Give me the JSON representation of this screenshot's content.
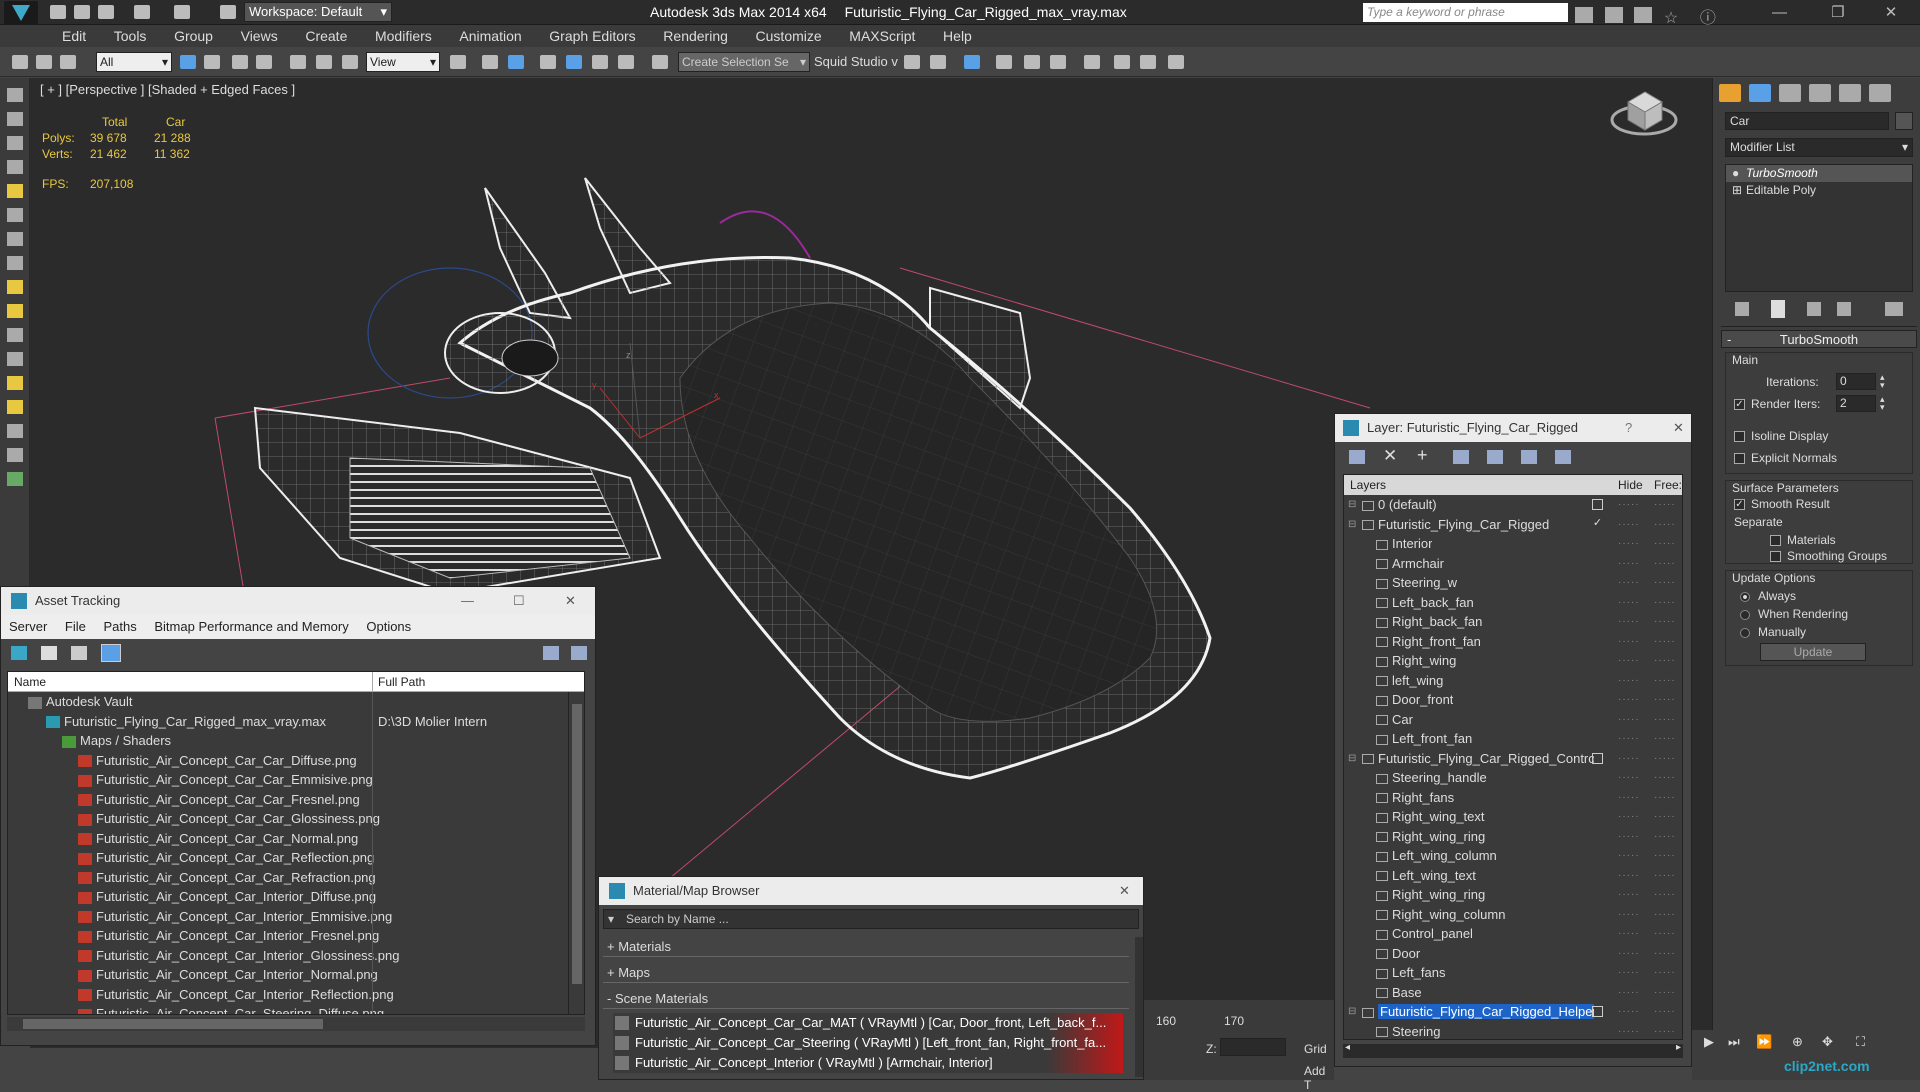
{
  "app": {
    "title": "Autodesk 3ds Max  2014 x64",
    "file": "Futuristic_Flying_Car_Rigged_max_vray.max",
    "workspace": "Workspace: Default",
    "search_placeholder": "Type a keyword or phrase"
  },
  "menu": [
    "Edit",
    "Tools",
    "Group",
    "Views",
    "Create",
    "Modifiers",
    "Animation",
    "Graph Editors",
    "Rendering",
    "Customize",
    "MAXScript",
    "Help"
  ],
  "toolbar": {
    "filter": "All",
    "view": "View",
    "selection_set": "Create Selection Se",
    "squid": "Squid Studio v"
  },
  "viewport": {
    "label": "[ + ] [Perspective ] [Shaded + Edged Faces ]",
    "stats": {
      "total_header": "Total",
      "car_header": "Car",
      "polys_label": "Polys:",
      "polys_total": "39 678",
      "polys_car": "21 288",
      "verts_label": "Verts:",
      "verts_total": "21 462",
      "verts_car": "11 362",
      "fps_label": "FPS:",
      "fps_value": "207,108"
    },
    "axis_x": "x",
    "axis_y": "y",
    "axis_z": "z"
  },
  "asset_tracking": {
    "title": "Asset Tracking",
    "menu": [
      "Server",
      "File",
      "Paths",
      "Bitmap Performance and Memory",
      "Options"
    ],
    "col_name": "Name",
    "col_path": "Full Path",
    "vault": "Autodesk Vault",
    "max_file": "Futuristic_Flying_Car_Rigged_max_vray.max",
    "max_path": "D:\\3D Molier Intern",
    "maps_folder": "Maps / Shaders",
    "files": [
      "Futuristic_Air_Concept_Car_Car_Diffuse.png",
      "Futuristic_Air_Concept_Car_Car_Emmisive.png",
      "Futuristic_Air_Concept_Car_Car_Fresnel.png",
      "Futuristic_Air_Concept_Car_Car_Glossiness.png",
      "Futuristic_Air_Concept_Car_Car_Normal.png",
      "Futuristic_Air_Concept_Car_Car_Reflection.png",
      "Futuristic_Air_Concept_Car_Car_Refraction.png",
      "Futuristic_Air_Concept_Car_Interior_Diffuse.png",
      "Futuristic_Air_Concept_Car_Interior_Emmisive.png",
      "Futuristic_Air_Concept_Car_Interior_Fresnel.png",
      "Futuristic_Air_Concept_Car_Interior_Glossiness.png",
      "Futuristic_Air_Concept_Car_Interior_Normal.png",
      "Futuristic_Air_Concept_Car_Interior_Reflection.png",
      "Futuristic_Air_Concept_Car_Steering_Diffuse.png"
    ]
  },
  "material_browser": {
    "title": "Material/Map Browser",
    "search_placeholder": "Search by Name ...",
    "groups": [
      "+ Materials",
      "+ Maps",
      "- Scene Materials"
    ],
    "materials": [
      "Futuristic_Air_Concept_Car_Car_MAT  ( VRayMtl ) [Car, Door_front, Left_back_f...",
      "Futuristic_Air_Concept_Car_Steering  ( VRayMtl ) [Left_front_fan, Right_front_fa...",
      "Futuristic_Air_Concept_Interior  ( VRayMtl ) [Armchair, Interior]"
    ]
  },
  "layer_window": {
    "title": "Layer: Futuristic_Flying_Car_Rigged",
    "help": "?",
    "col_layers": "Layers",
    "col_hide": "Hide",
    "col_freeze": "Free:",
    "rows": [
      {
        "label": "0 (default)",
        "level": 0,
        "group": true
      },
      {
        "label": "Futuristic_Flying_Car_Rigged",
        "level": 0,
        "group": true
      },
      {
        "label": "Interior",
        "level": 1,
        "group": false
      },
      {
        "label": "Armchair",
        "level": 1,
        "group": false
      },
      {
        "label": "Steering_w",
        "level": 1,
        "group": false
      },
      {
        "label": "Left_back_fan",
        "level": 1,
        "group": false
      },
      {
        "label": "Right_back_fan",
        "level": 1,
        "group": false
      },
      {
        "label": "Right_front_fan",
        "level": 1,
        "group": false
      },
      {
        "label": "Right_wing",
        "level": 1,
        "group": false
      },
      {
        "label": "left_wing",
        "level": 1,
        "group": false
      },
      {
        "label": "Door_front",
        "level": 1,
        "group": false
      },
      {
        "label": "Car",
        "level": 1,
        "group": false
      },
      {
        "label": "Left_front_fan",
        "level": 1,
        "group": false
      },
      {
        "label": "Futuristic_Flying_Car_Rigged_Contro",
        "level": 0,
        "group": true
      },
      {
        "label": "Steering_handle",
        "level": 1,
        "group": false
      },
      {
        "label": "Right_fans",
        "level": 1,
        "group": false
      },
      {
        "label": "Right_wing_text",
        "level": 1,
        "group": false
      },
      {
        "label": "Right_wing_ring",
        "level": 1,
        "group": false
      },
      {
        "label": "Left_wing_column",
        "level": 1,
        "group": false
      },
      {
        "label": "Left_wing_text",
        "level": 1,
        "group": false
      },
      {
        "label": "Right_wing_ring",
        "level": 1,
        "group": false
      },
      {
        "label": "Right_wing_column",
        "level": 1,
        "group": false
      },
      {
        "label": "Control_panel",
        "level": 1,
        "group": false
      },
      {
        "label": "Door",
        "level": 1,
        "group": false
      },
      {
        "label": "Left_fans",
        "level": 1,
        "group": false
      },
      {
        "label": "Base",
        "level": 1,
        "group": false
      },
      {
        "label": "Futuristic_Flying_Car_Rigged_Helper",
        "level": 0,
        "group": true,
        "selected": true
      },
      {
        "label": "Steering",
        "level": 1,
        "group": false
      }
    ]
  },
  "command_panel": {
    "object_name": "Car",
    "modifier_list": "Modifier List",
    "stack": [
      "TurboSmooth",
      "Editable Poly"
    ],
    "rollout_title": "TurboSmooth",
    "main_label": "Main",
    "iterations_label": "Iterations:",
    "iterations_value": "0",
    "render_iters_label": "Render Iters:",
    "render_iters_value": "2",
    "isoline": "Isoline Display",
    "explicit_normals": "Explicit Normals",
    "surface_params": "Surface Parameters",
    "smooth_result": "Smooth Result",
    "separate": "Separate",
    "materials": "Materials",
    "smoothing_groups": "Smoothing Groups",
    "update_options": "Update Options",
    "always": "Always",
    "when_rendering": "When Rendering",
    "manually": "Manually",
    "update_button": "Update"
  },
  "timeline": {
    "tick_160": "160",
    "tick_170": "170",
    "z_label": "Z:",
    "grid_label": "Grid",
    "add_label": "Add T"
  },
  "watermark": "clip2net.com",
  "colors": {
    "selection_blue": "#1e64c8",
    "material_red": "#c01818",
    "accent_yellow": "#e8c840"
  }
}
